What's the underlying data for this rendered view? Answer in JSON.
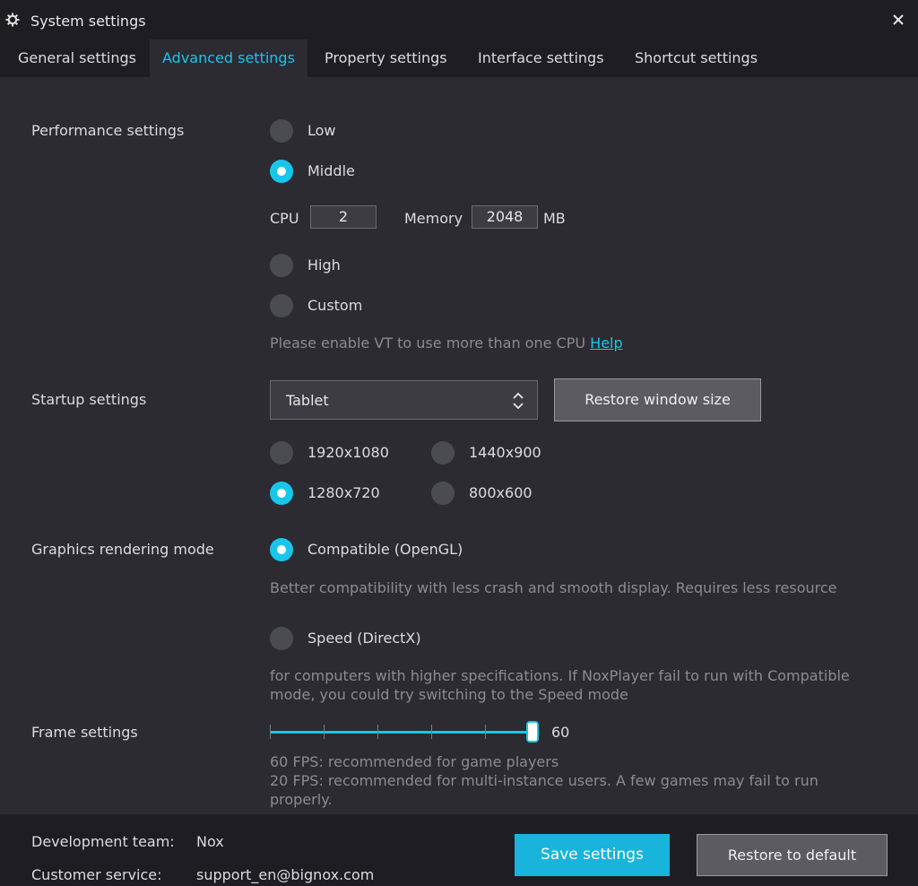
{
  "window": {
    "title": "System settings",
    "gear_icon": "gear-icon",
    "close_icon": "close-icon"
  },
  "tabs": [
    {
      "label": "General settings",
      "active": false
    },
    {
      "label": "Advanced settings",
      "active": true
    },
    {
      "label": "Property settings",
      "active": false
    },
    {
      "label": "Interface settings",
      "active": false
    },
    {
      "label": "Shortcut settings",
      "active": false
    }
  ],
  "performance": {
    "label": "Performance settings",
    "options": [
      {
        "label": "Low",
        "selected": false
      },
      {
        "label": "Middle",
        "selected": true
      },
      {
        "label": "High",
        "selected": false
      },
      {
        "label": "Custom",
        "selected": false
      }
    ],
    "cpu_label": "CPU",
    "cpu_value": "2",
    "memory_label": "Memory",
    "memory_value": "2048",
    "memory_unit": "MB",
    "vt_hint": "Please enable VT to use more than one CPU",
    "help_link": "Help"
  },
  "startup": {
    "label": "Startup settings",
    "device_select": "Tablet",
    "restore_window_button": "Restore window size",
    "resolutions": [
      {
        "label": "1920x1080",
        "selected": false
      },
      {
        "label": "1440x900",
        "selected": false
      },
      {
        "label": "1280x720",
        "selected": true
      },
      {
        "label": "800x600",
        "selected": false
      }
    ]
  },
  "graphics": {
    "label": "Graphics rendering mode",
    "compatible_label": "Compatible (OpenGL)",
    "compatible_selected": true,
    "compatible_hint": "Better compatibility with less crash and smooth display. Requires less resource",
    "speed_label": "Speed (DirectX)",
    "speed_selected": false,
    "speed_hint_1": "for computers with higher specifications. If NoxPlayer fail to run with Compatible",
    "speed_hint_2": "mode, you could try switching to the Speed mode"
  },
  "frame": {
    "label": "Frame settings",
    "value": "60",
    "slider_fraction": 1.0,
    "hint_1": "60 FPS: recommended for game players",
    "hint_2": "20 FPS: recommended for multi-instance users. A few games may fail to run",
    "hint_3": "properly."
  },
  "footer": {
    "dev_team_label": "Development team:",
    "dev_team_value": "Nox",
    "service_label": "Customer service:",
    "service_value": "support_en@bignox.com",
    "save_button": "Save settings",
    "restore_default_button": "Restore to default"
  },
  "colors": {
    "accent": "#18c6ec",
    "background": "#2b2b31",
    "bar": "#1e1e22"
  }
}
